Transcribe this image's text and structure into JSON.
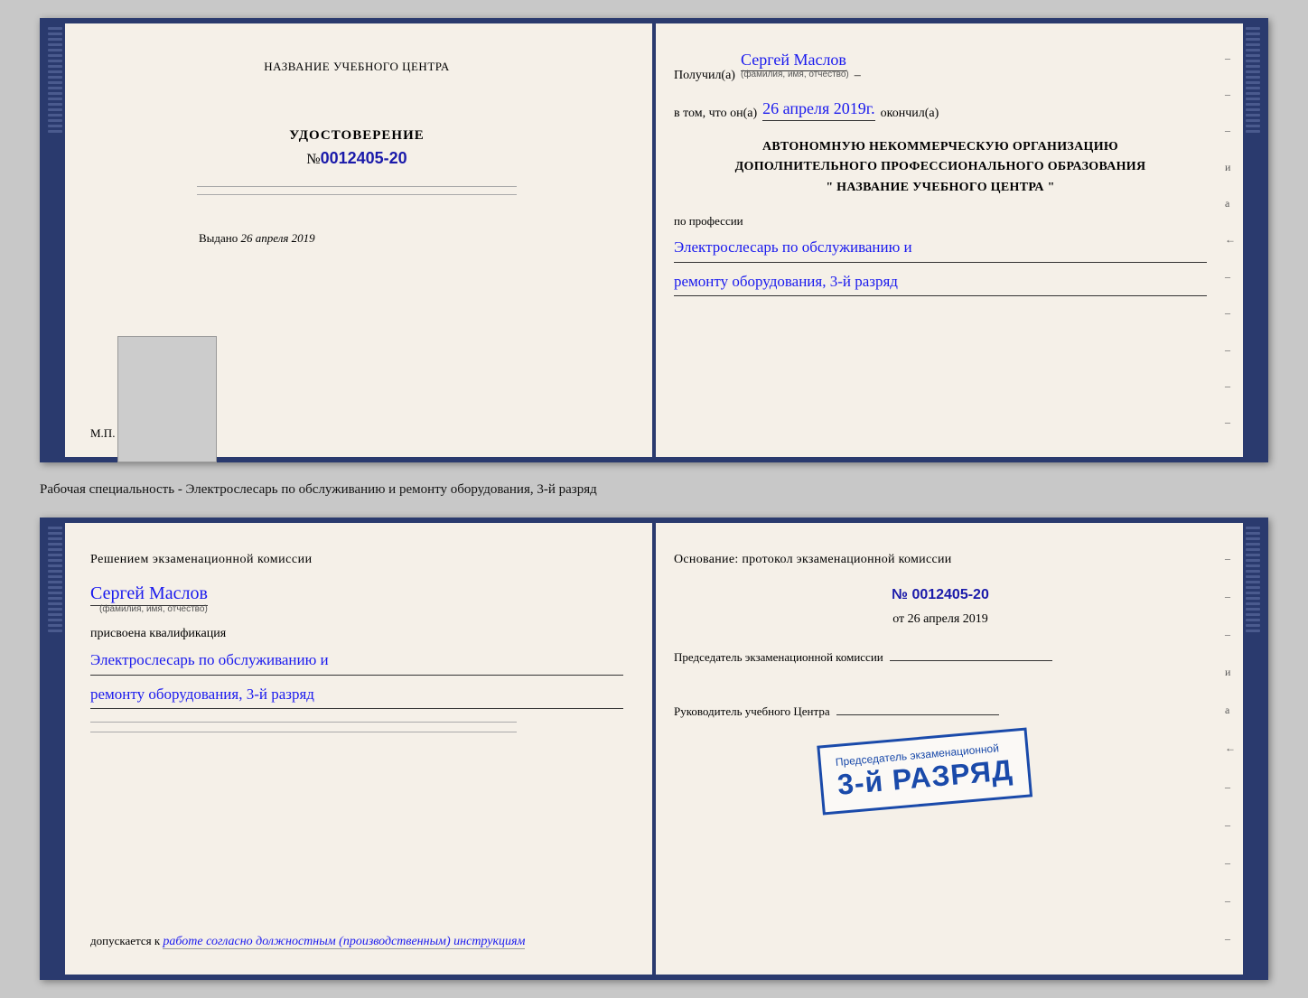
{
  "book1": {
    "left": {
      "title": "НАЗВАНИЕ УЧЕБНОГО ЦЕНТРА",
      "udostoverenie_label": "УДОСТОВЕРЕНИЕ",
      "number_prefix": "№",
      "number": "0012405-20",
      "vydano_label": "Выдано",
      "vydano_date": "26 апреля 2019",
      "mp_label": "М.П."
    },
    "right": {
      "poluchil_label": "Получил(а)",
      "poluchil_name": "Сергей Маслов",
      "fio_sublabel": "(фамилия, имя, отчество)",
      "vtom_label": "в том, что он(а)",
      "vtom_date": "26 апреля 2019г.",
      "okonchil": "окончил(а)",
      "org_line1": "АВТОНОМНУЮ НЕКОММЕРЧЕСКУЮ ОРГАНИЗАЦИЮ",
      "org_line2": "ДОПОЛНИТЕЛЬНОГО ПРОФЕССИОНАЛЬНОГО ОБРАЗОВАНИЯ",
      "org_line3": "\"   НАЗВАНИЕ УЧЕБНОГО ЦЕНТРА   \"",
      "po_professii": "по профессии",
      "profession1": "Электрослесарь по обслуживанию и",
      "profession2": "ремонту оборудования, 3-й разряд"
    }
  },
  "caption": {
    "text": "Рабочая специальность - Электрослесарь по обслуживанию и ремонту оборудования, 3-й разряд"
  },
  "book2": {
    "left": {
      "resheniem_label": "Решением экзаменационной комиссии",
      "name": "Сергей Маслов",
      "fio_sublabel": "(фамилия, имя, отчество)",
      "prisvoena": "присвоена квалификация",
      "profession1": "Электрослесарь по обслуживанию и",
      "profession2": "ремонту оборудования, 3-й разряд",
      "dopuskaetsya_label": "допускается к",
      "dopuskaetsya_value": "работе согласно должностным (производственным) инструкциям"
    },
    "right": {
      "osnovanie_label": "Основание: протокол экзаменационной комиссии",
      "number_prefix": "№",
      "number": "0012405-20",
      "ot_label": "от",
      "ot_date": "26 апреля 2019",
      "predsedatel_label": "Председатель экзаменационной комиссии",
      "rukovoditel_label": "Руководитель учебного Центра"
    },
    "stamp": {
      "label": "3-й РАЗРЯД",
      "top_label": "Председатель экзаменационной"
    }
  },
  "dashes_right": [
    "–",
    "–",
    "–",
    "и",
    "а",
    "←",
    "–",
    "–",
    "–",
    "–",
    "–"
  ]
}
